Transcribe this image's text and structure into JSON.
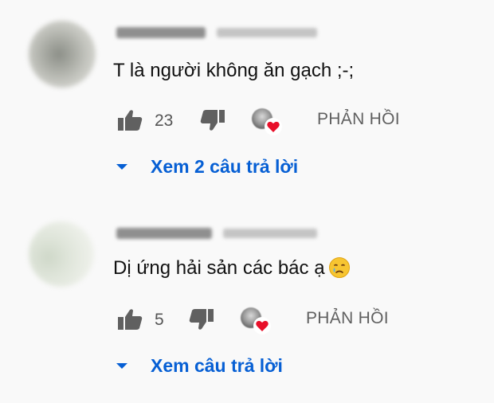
{
  "colors": {
    "background": "#f9f9f9",
    "link_blue": "#065fd4",
    "secondary_text": "#606060",
    "heart_red": "#e8102a"
  },
  "comments": [
    {
      "author_name_blurred": true,
      "timestamp_blurred": true,
      "text": "T là người không ăn gạch ;-;",
      "emoji": "",
      "like_icon": "thumbs-up-icon",
      "like_count": "23",
      "dislike_icon": "thumbs-down-icon",
      "creator_heart": true,
      "reply_label": "PHẢN HỒI",
      "view_replies_label": "Xem 2 câu trả lời"
    },
    {
      "author_name_blurred": true,
      "timestamp_blurred": true,
      "text": "Dị ứng hải sản các bác ạ",
      "emoji": "crying-face-icon",
      "like_icon": "thumbs-up-icon",
      "like_count": "5",
      "dislike_icon": "thumbs-down-icon",
      "creator_heart": true,
      "reply_label": "PHẢN HỒI",
      "view_replies_label": "Xem câu trả lời"
    }
  ]
}
